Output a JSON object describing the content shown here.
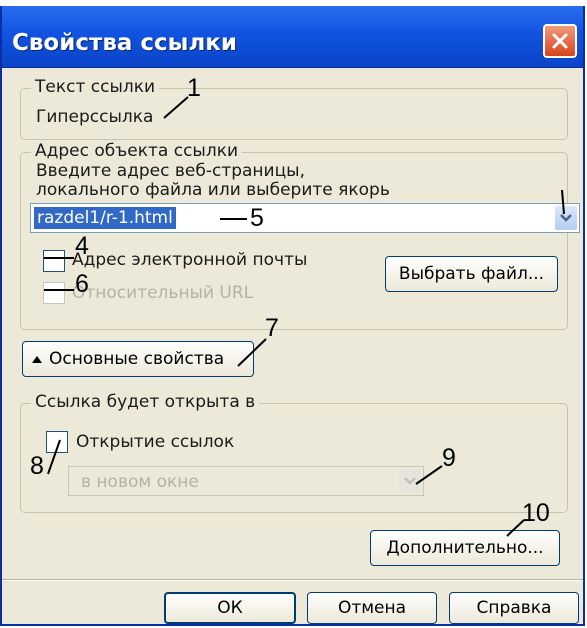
{
  "window": {
    "title": "Свойства ссылки"
  },
  "link_text_group": {
    "legend": "Текст ссылки",
    "value": "Гиперссылка"
  },
  "address_group": {
    "legend": "Адрес объекта ссылки",
    "hint_line1": "Введите адрес веб-страницы,",
    "hint_line2": "локального файла или выберите якорь",
    "url_value": "razdel1/r-1.html",
    "email_checkbox_label": "Адрес электронной почты",
    "relative_checkbox_label": "Относительный URL",
    "choose_file_label": "Выбрать файл..."
  },
  "main_props_button": {
    "label": "Основные свойства"
  },
  "open_group": {
    "legend": "Ссылка будет открыта в",
    "open_checkbox_label": "Открытие ссылок",
    "target_value": "в новом окне"
  },
  "advanced_button": {
    "label": "Дополнительно..."
  },
  "footer": {
    "ok_label": "ОК",
    "cancel_label": "Отмена",
    "help_label": "Справка"
  },
  "callouts": {
    "c1": "1",
    "c4": "4",
    "c5": "5",
    "c6": "6",
    "c7": "7",
    "c8": "8",
    "c9": "9",
    "c10": "10"
  },
  "colors": {
    "title_bar": "#1153e0",
    "dialog_bg": "#ece9d8",
    "selection": "#3169c6",
    "close": "#d8431b"
  },
  "icons": [
    "close-icon",
    "chevron-down-icon",
    "triangle-up-icon"
  ]
}
